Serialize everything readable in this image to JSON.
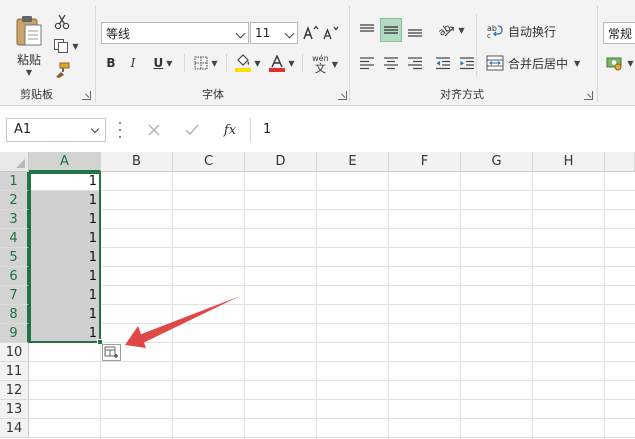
{
  "ribbon": {
    "clipboard": {
      "paste_label": "粘贴",
      "group_label": "剪贴板"
    },
    "font": {
      "font_name": "等线",
      "font_size": "11",
      "bold": "B",
      "italic": "I",
      "underline": "U",
      "group_label": "字体",
      "font_color": "#e03030",
      "fill_color": "#f5e100",
      "phonetic_top": "wén",
      "phonetic_bottom": "文"
    },
    "alignment": {
      "wrap_text_label": "自动换行",
      "merge_label": "合并后居中",
      "group_label": "对齐方式"
    },
    "number": {
      "format_value": "常规"
    }
  },
  "formula_bar": {
    "name_box": "A1",
    "fx_label": "fx",
    "formula": "1"
  },
  "grid": {
    "columns": [
      "A",
      "B",
      "C",
      "D",
      "E",
      "F",
      "G",
      "H"
    ],
    "rows": [
      "1",
      "2",
      "3",
      "4",
      "5",
      "6",
      "7",
      "8",
      "9",
      "10",
      "11",
      "12",
      "13",
      "14"
    ],
    "column_a_values": [
      "1",
      "1",
      "1",
      "1",
      "1",
      "1",
      "1",
      "1",
      "1"
    ]
  },
  "colors": {
    "accent": "#217346",
    "arrow": "#e04848"
  }
}
